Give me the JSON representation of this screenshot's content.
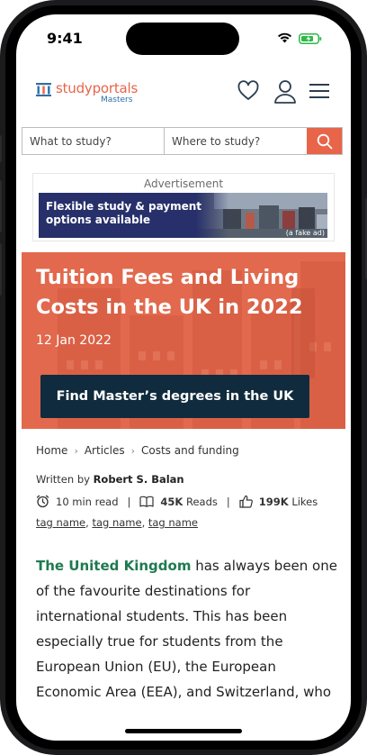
{
  "status_bar": {
    "time": "9:41"
  },
  "header": {
    "logo_text": "studyportals",
    "logo_sub": "Masters"
  },
  "search": {
    "what_placeholder": "What to study?",
    "where_placeholder": "Where to study?"
  },
  "ad": {
    "label": "Advertisement",
    "headline": "Flexible study & payment options available",
    "tag": "(a fake ad)",
    "banner_color": "#27306a"
  },
  "hero": {
    "title": "Tuition Fees and Living Costs in the UK in 2022",
    "date": "12 Jan 2022",
    "cta": "Find Master’s degrees in the UK",
    "color": "#e2694d"
  },
  "breadcrumb": [
    "Home",
    "Articles",
    "Costs and funding"
  ],
  "article": {
    "written_by": "Written by",
    "author": "Robert S. Balan",
    "read_time": "10 min read",
    "reads_count": "45K",
    "reads_label": "Reads",
    "likes_count": "199K",
    "likes_label": "Likes",
    "tags": [
      "tag name",
      "tag name",
      "tag name"
    ],
    "highlight": "The United Kingdom",
    "body": " has always been one of the favourite destinations for international students. This has been especially true for students from the European Union (EU), the European Economic Area (EEA), and Switzerland, who"
  },
  "colors": {
    "accent": "#e8654a",
    "link_green": "#1f7a4f",
    "navy": "#0f2b3d"
  }
}
